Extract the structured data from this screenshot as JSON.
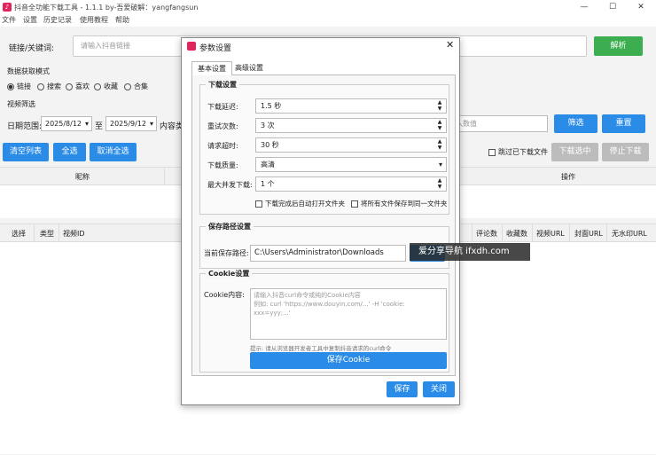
{
  "app": {
    "title": "抖音全功能下载工具 - 1.1.1   by-吾爱破解：yangfangsun",
    "menu": [
      "文件",
      "设置",
      "历史记录",
      "使用教程",
      "帮助"
    ]
  },
  "link": {
    "label": "链接/关键词:",
    "placeholder": "请输入抖音链接",
    "parse_button": "解析"
  },
  "mode": {
    "label": "数据获取模式",
    "options": [
      "链接",
      "搜索",
      "喜欢",
      "收藏",
      "合集"
    ],
    "selected": "链接"
  },
  "filter": {
    "label": "视频筛选",
    "date_label": "日期范围:",
    "date_from": "2025/8/12",
    "to": "至",
    "date_to": "2025/9/12",
    "content_type_label": "内容类",
    "value_placeholder": "入数值",
    "filter_button": "筛选",
    "reset_button": "重置"
  },
  "actions": {
    "clear_list": "清空列表",
    "select_all": "全选",
    "deselect_all": "取消全选",
    "skip_downloaded": "跳过已下载文件",
    "download_selected": "下载选中",
    "stop_download": "停止下载"
  },
  "table1": {
    "headers": [
      "昵称",
      "操作"
    ]
  },
  "table2": {
    "headers": [
      "选择",
      "类型",
      "视频ID",
      "评论数",
      "收藏数",
      "视频URL",
      "封面URL",
      "无水印URL"
    ]
  },
  "dialog": {
    "title": "参数设置",
    "tabs": [
      "基本设置",
      "高级设置"
    ],
    "download_section": {
      "title": "下载设置",
      "delay_label": "下载延迟:",
      "delay_value": "1.5 秒",
      "retry_label": "重试次数:",
      "retry_value": "3 次",
      "timeout_label": "请求超时:",
      "timeout_value": "30 秒",
      "quality_label": "下载质量:",
      "quality_value": "高清",
      "concurrency_label": "最大并发下载:",
      "concurrency_value": "1 个",
      "open_folder_label": "下载完成后自动打开文件夹",
      "same_folder_label": "将所有文件保存到同一文件夹"
    },
    "path_section": {
      "title": "保存路径设置",
      "label": "当前保存路径:",
      "value": "C:\\Users\\Administrator\\Downloads"
    },
    "cookie_section": {
      "title": "Cookie设置",
      "label": "Cookie内容:",
      "placeholder": "请输入抖音curl命令或纯的Cookie内容\n例如: curl 'https://www.douyin.com/...' -H 'cookie: xxx=yyy;...'",
      "hint": "提示: 请从浏览器开发者工具中复制抖音请求的curl命令",
      "save_cookie_button": "保存Cookie"
    },
    "save_button": "保存",
    "close_button": "关闭"
  },
  "watermark": "爱分享导航  ifxdh.com",
  "colors": {
    "accent": "#2b8ce8",
    "parse": "#3cae4f",
    "disabled": "#bcbcbc",
    "app_icon": "#e0245e"
  }
}
